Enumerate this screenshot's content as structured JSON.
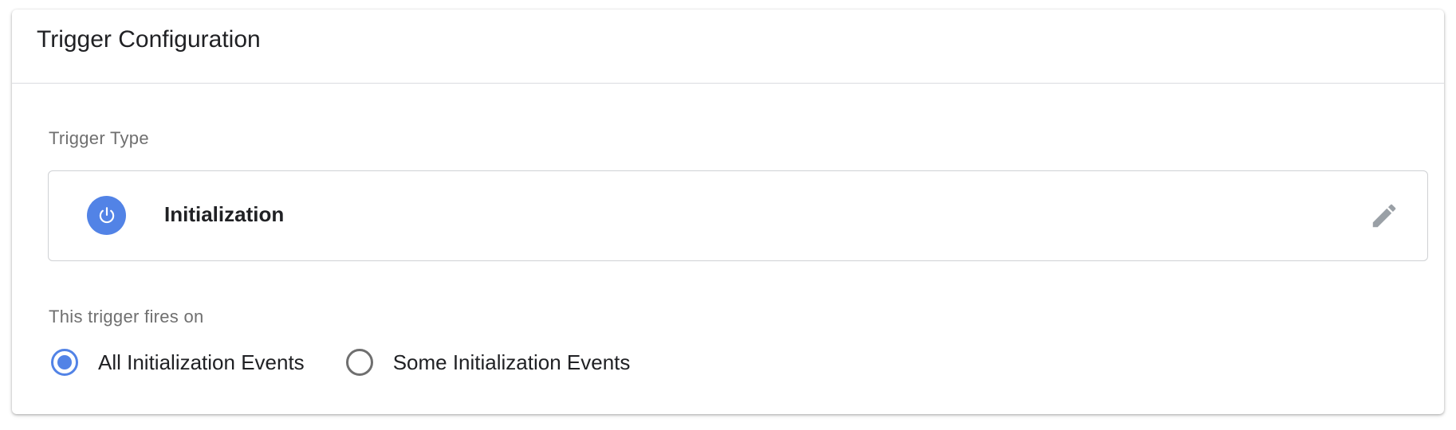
{
  "card": {
    "title": "Trigger Configuration"
  },
  "trigger_type": {
    "label": "Trigger Type",
    "name": "Initialization",
    "icon": "power-icon",
    "icon_color": "#5283e6",
    "edit_icon": "pencil-icon"
  },
  "fires_on": {
    "label": "This trigger fires on",
    "options": [
      {
        "label": "All Initialization Events",
        "checked": true
      },
      {
        "label": "Some Initialization Events",
        "checked": false
      }
    ],
    "accent_color": "#5283e6"
  }
}
